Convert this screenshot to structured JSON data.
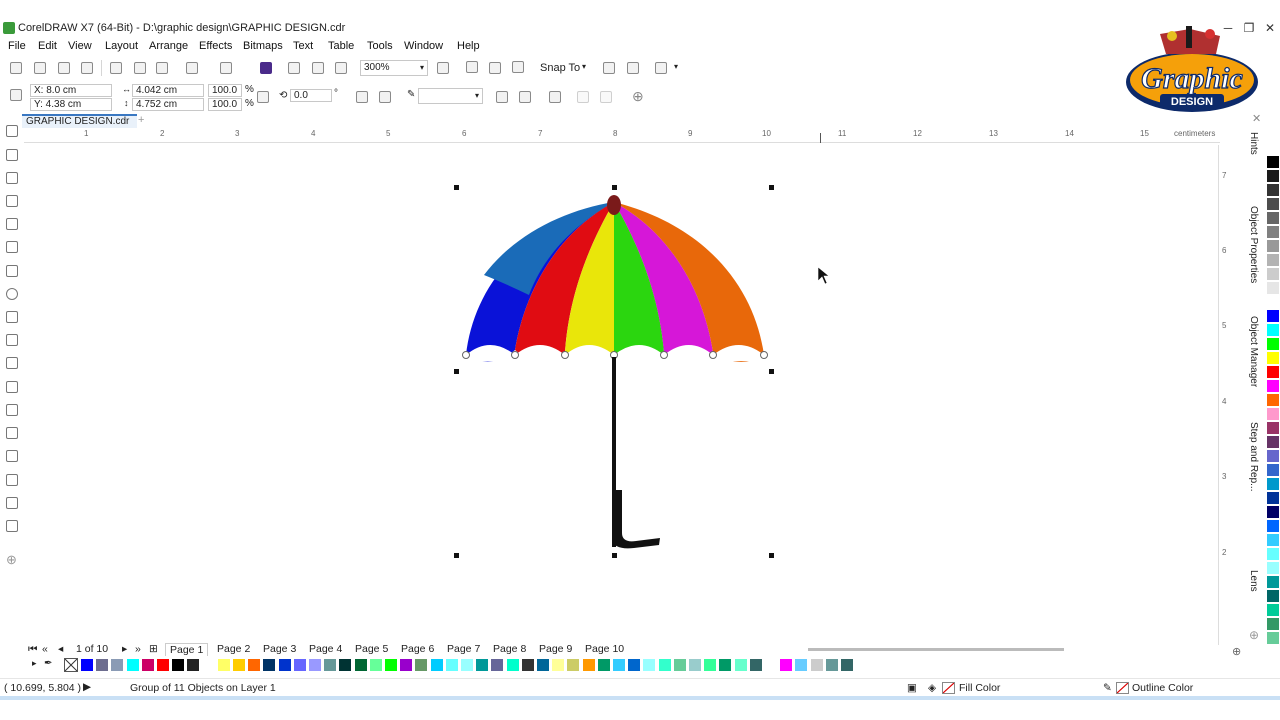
{
  "window": {
    "title": "CorelDRAW X7 (64-Bit) - D:\\graphic design\\GRAPHIC DESIGN.cdr",
    "minimize": "─",
    "restore": "❐",
    "close": "✕"
  },
  "menu": [
    "File",
    "Edit",
    "View",
    "Layout",
    "Arrange",
    "Effects",
    "Bitmaps",
    "Text",
    "Table",
    "Tools",
    "Window",
    "Help"
  ],
  "toolbar": {
    "zoom": "300%",
    "snap_label": "Snap To"
  },
  "property_bar": {
    "x": "X: 8.0 cm",
    "y": "Y: 4.38 cm",
    "width": "4.042 cm",
    "height": "4.752 cm",
    "scale_w": "100.0",
    "scale_h": "100.0",
    "percent": "%",
    "rotation": "0.0",
    "degree": "°"
  },
  "logo": {
    "line1": "Graphic",
    "line2": "DESIGN"
  },
  "document_tab": "GRAPHIC DESIGN.cdr",
  "ruler": {
    "unit": "centimeters",
    "h_numbers": [
      "1",
      "2",
      "3",
      "4",
      "5",
      "6",
      "7",
      "8",
      "9",
      "10",
      "11",
      "12",
      "13",
      "14",
      "15"
    ],
    "v_numbers": [
      "7",
      "6",
      "5",
      "4",
      "3",
      "2"
    ]
  },
  "dockers": [
    "Hints",
    "Object Properties",
    "Object Manager",
    "Step and Rep...",
    "Lens"
  ],
  "page_nav": {
    "counter": "1 of 10",
    "pages": [
      "Page 1",
      "Page 2",
      "Page 3",
      "Page 4",
      "Page 5",
      "Page 6",
      "Page 7",
      "Page 8",
      "Page 9",
      "Page 10"
    ],
    "active": "Page 1"
  },
  "status": {
    "coords": "( 10.699, 5.804 )",
    "selection": "Group of 11 Objects on Layer 1",
    "fill": "Fill Color",
    "outline": "Outline Color"
  },
  "colors": {
    "accent": "#3a78c2",
    "umbrella_panels": [
      "#0a12d8",
      "#1a6bb8",
      "#e00c12",
      "#e9e60a",
      "#2bd60f",
      "#d617d8",
      "#e8680a"
    ]
  },
  "palette_vertical": [
    "#000000",
    "#1a1a1a",
    "#333333",
    "#4d4d4d",
    "#666666",
    "#808080",
    "#999999",
    "#b3b3b3",
    "#cccccc",
    "#e6e6e6",
    "#ffffff",
    "#0000ff",
    "#00ffff",
    "#00ff00",
    "#ffff00",
    "#ff0000",
    "#ff00ff",
    "#ff6600",
    "#ff99cc",
    "#993366",
    "#663366",
    "#6666cc",
    "#3366cc",
    "#0099cc",
    "#003399",
    "#000066",
    "#0066ff",
    "#33ccff",
    "#66ffff",
    "#99ffff",
    "#009999",
    "#006666",
    "#00cc99",
    "#339966",
    "#66cc99"
  ],
  "palette_horizontal": [
    "#0000ff",
    "#6d6d8f",
    "#8a9bb5",
    "#00ffff",
    "#cc0066",
    "#ff0000",
    "#000000",
    "#222222",
    "#ffffff",
    "#ffff66",
    "#ffcc00",
    "#ff6600",
    "#003366",
    "#0033cc",
    "#6666ff",
    "#9999ff",
    "#669999",
    "#003333",
    "#006633",
    "#66ff99",
    "#00ff00",
    "#9900cc",
    "#669966",
    "#00ccff",
    "#66ffff",
    "#99ffff",
    "#009999",
    "#666699",
    "#00ffcc",
    "#333333",
    "#006699",
    "#ffff99",
    "#cccc66",
    "#ff9900",
    "#009966",
    "#33ccff",
    "#0066cc",
    "#99ffff",
    "#33ffcc",
    "#66cc99",
    "#99cccc",
    "#33ff99",
    "#009966",
    "#66ffcc",
    "#336666",
    "#ffffff",
    "#ff00ff",
    "#66ccff",
    "#cccccc",
    "#669999",
    "#336666"
  ]
}
